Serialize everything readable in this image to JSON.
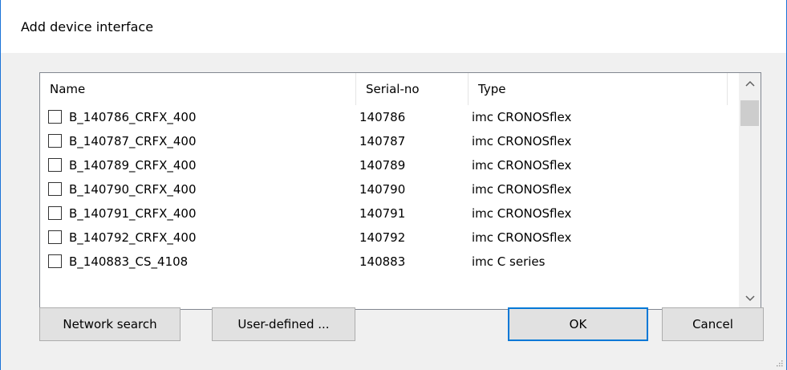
{
  "dialog": {
    "title": "Add device interface"
  },
  "list": {
    "columns": [
      "Name",
      "Serial-no",
      "Type"
    ],
    "rows": [
      {
        "name": "B_140786_CRFX_400",
        "serial": "140786",
        "type": "imc CRONOSflex",
        "checked": false
      },
      {
        "name": "B_140787_CRFX_400",
        "serial": "140787",
        "type": "imc CRONOSflex",
        "checked": false
      },
      {
        "name": "B_140789_CRFX_400",
        "serial": "140789",
        "type": "imc CRONOSflex",
        "checked": false
      },
      {
        "name": "B_140790_CRFX_400",
        "serial": "140790",
        "type": "imc CRONOSflex",
        "checked": false
      },
      {
        "name": "B_140791_CRFX_400",
        "serial": "140791",
        "type": "imc CRONOSflex",
        "checked": false
      },
      {
        "name": "B_140792_CRFX_400",
        "serial": "140792",
        "type": "imc CRONOSflex",
        "checked": false
      },
      {
        "name": "B_140883_CS_4108",
        "serial": "140883",
        "type": "imc C series",
        "checked": false
      }
    ]
  },
  "buttons": {
    "network_search": "Network search",
    "user_defined": "User-defined ...",
    "ok": "OK",
    "cancel": "Cancel"
  },
  "icons": {
    "scroll_up": "chevron-up-icon",
    "scroll_down": "chevron-down-icon",
    "resize_grip": "resize-grip-icon"
  },
  "colors": {
    "window_border": "#1a73d8",
    "default_button_border": "#0078d7",
    "dialog_background": "#f0f0f0"
  }
}
